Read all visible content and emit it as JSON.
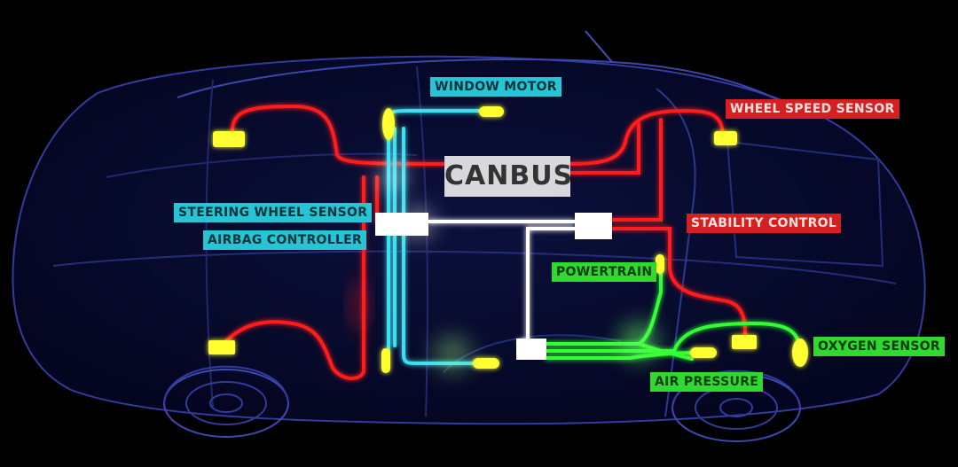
{
  "colors": {
    "can_bus_wire": "#ffffff",
    "comfort_bus_wire": "#3ee0f0",
    "chassis_bus_wire": "#ff1a1a",
    "powertrain_bus_wire": "#33ff33",
    "sensor_node": "#ffff33",
    "car_outline": "#2f3a9a"
  },
  "labels": {
    "canbus": "CANBUS",
    "window_motor": "WINDOW MOTOR",
    "wheel_speed_sensor": "WHEEL SPEED SENSOR",
    "steering_wheel_sensor": "STEERING WHEEL SENSOR",
    "airbag_controller": "AIRBAG CONTROLLER",
    "stability_control": "STABILITY CONTROL",
    "powertrain": "POWERTRAIN",
    "oxygen_sensor": "OXYGEN SENSOR",
    "air_pressure": "AIR PRESSURE"
  }
}
